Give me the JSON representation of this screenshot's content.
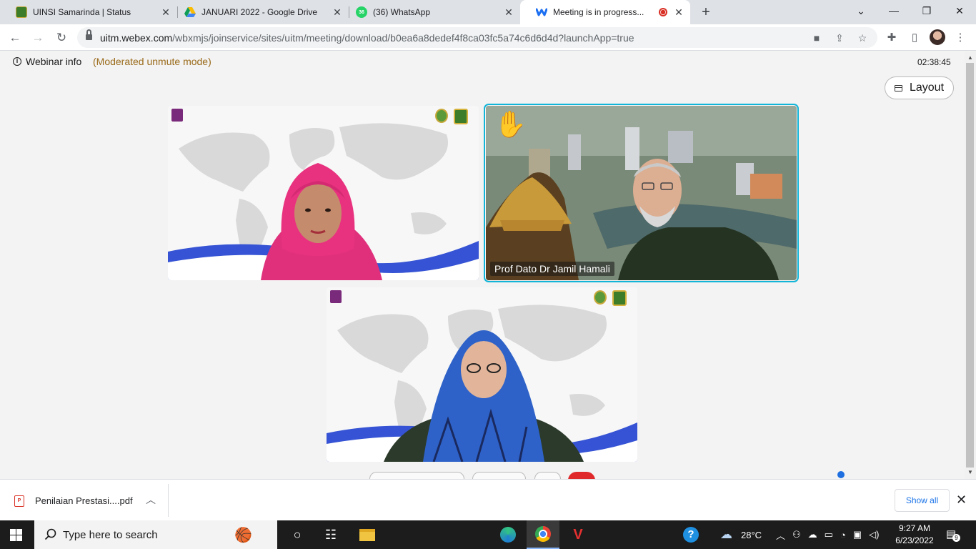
{
  "browser": {
    "tabs": [
      {
        "title": "UINSI Samarinda | Status",
        "favicon": "uinsi-logo-icon",
        "active": false
      },
      {
        "title": "JANUARI 2022 - Google Drive",
        "favicon": "google-drive-icon",
        "active": false
      },
      {
        "title": "(36) WhatsApp",
        "favicon": "whatsapp-icon",
        "badge": "36",
        "active": false
      },
      {
        "title": "Meeting is in progress...",
        "favicon": "webex-icon",
        "active": true
      }
    ],
    "url_host": "uitm.webex.com",
    "url_path": "/wbxmjs/joinservice/sites/uitm/meeting/download/b0ea6a8dedef4f8ca03fc5a74c6d6d4d?launchApp=true"
  },
  "meeting": {
    "webinar_info": "Webinar info",
    "mode": "(Moderated unmute mode)",
    "elapsed": "02:38:45",
    "layout_label": "Layout",
    "participants": [
      {
        "name": "",
        "raised_hand": false,
        "active_speaker": false
      },
      {
        "name": "Prof Dato Dr Jamil Hamali",
        "raised_hand": true,
        "active_speaker": true
      },
      {
        "name": "",
        "raised_hand": false,
        "active_speaker": false
      }
    ],
    "colors": {
      "active_speaker_border": "#12b5d8",
      "end_button": "#e0292b",
      "mode_text": "#9a6a1a"
    }
  },
  "downloads": {
    "file_name": "Penilaian Prestasi....pdf",
    "show_all": "Show all"
  },
  "taskbar": {
    "search_placeholder": "Type here to search",
    "weather": "28°C",
    "time": "9:27 AM",
    "date": "6/23/2022",
    "notification_count": "9"
  }
}
